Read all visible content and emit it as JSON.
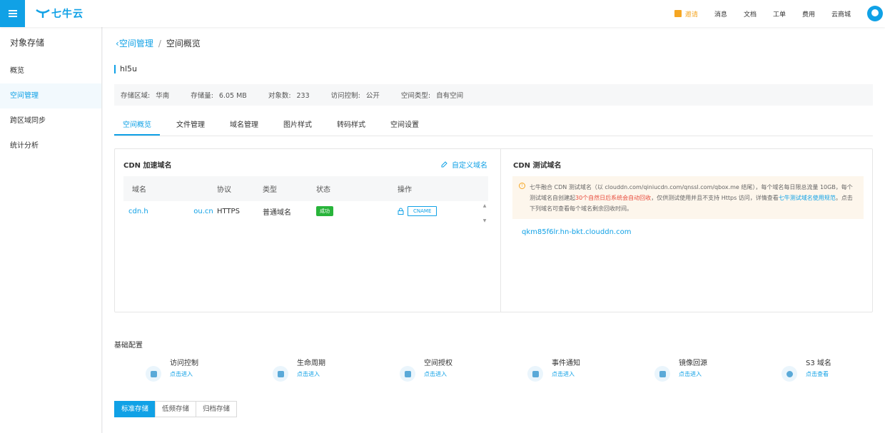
{
  "topbar": {
    "brand": "七牛云",
    "nav": [
      "邀请",
      "消息",
      "文档",
      "工单",
      "费用",
      "云商城"
    ]
  },
  "sidebar": {
    "title": "对象存储",
    "items": [
      {
        "label": "概览"
      },
      {
        "label": "空间管理"
      },
      {
        "label": "跨区域同步"
      },
      {
        "label": "统计分析"
      }
    ]
  },
  "breadcrumb": {
    "back": "空间管理",
    "sep": "/",
    "current": "空间概览"
  },
  "bucket": {
    "name": "hl5u"
  },
  "info": [
    {
      "k": "存储区域:",
      "v": "华南"
    },
    {
      "k": "存储量:",
      "v": "6.05 MB"
    },
    {
      "k": "对象数:",
      "v": "233"
    },
    {
      "k": "访问控制:",
      "v": "公开"
    },
    {
      "k": "空间类型:",
      "v": "自有空间"
    }
  ],
  "tabs": [
    "空间概览",
    "文件管理",
    "域名管理",
    "图片样式",
    "转码样式",
    "空间设置"
  ],
  "cdn": {
    "title": "CDN 加速域名",
    "custom": "自定义域名",
    "headers": [
      "域名",
      "协议",
      "类型",
      "状态",
      "操作"
    ],
    "rows": [
      {
        "domain": "cdn.h                    ou.cn",
        "protocol": "HTTPS",
        "type": "普通域名",
        "status": "成功",
        "op": "CNAME"
      }
    ]
  },
  "test": {
    "title": "CDN 测试域名",
    "notice_a": "七牛融合 CDN 测试域名（以 clouddn.com/qiniucdn.com/qnssl.com/qbox.me 结尾），每个域名每日限总流量 10GB，每个测试域名自创建起",
    "notice_red": "30个自然日后系统会自动回收",
    "notice_b": "，仅供测试使用并且不支持 Https 访问，详情查看",
    "notice_link": "七牛测试域名使用规范",
    "notice_c": "。点击下列域名可查看每个域名剩余回收时间。",
    "domain": "qkm85f6lr.hn-bkt.clouddn.com"
  },
  "base": {
    "title": "基础配置",
    "features": [
      {
        "name": "访问控制",
        "link": "点击进入",
        "icon": "user-lock-icon"
      },
      {
        "name": "生命周期",
        "link": "点击进入",
        "icon": "lifecycle-icon"
      },
      {
        "name": "空间授权",
        "link": "点击进入",
        "icon": "authorize-icon"
      },
      {
        "name": "事件通知",
        "link": "点击进入",
        "icon": "notify-icon"
      },
      {
        "name": "镜像回源",
        "link": "点击进入",
        "icon": "mirror-icon"
      },
      {
        "name": "S3 域名",
        "link": "点击查看",
        "icon": "globe-icon"
      }
    ]
  },
  "storage_tabs": [
    "标准存储",
    "低频存储",
    "归档存储"
  ],
  "colors": {
    "accent": "#10a1e6",
    "success": "#28b43a",
    "warning": "#f5a623",
    "danger": "#e84c3d"
  }
}
